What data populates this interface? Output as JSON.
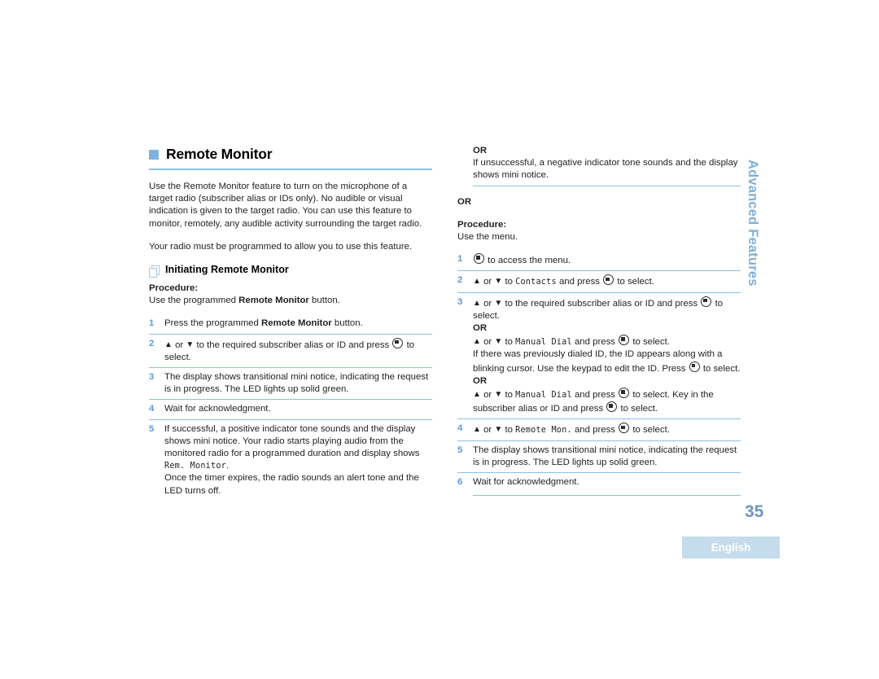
{
  "document": {
    "chapter_title": "Remote Monitor",
    "side_tab": "Advanced Features",
    "page_number": "35",
    "language_badge": "English",
    "accent_blue": "#8cc0e4",
    "number_blue": "#5b9bd5",
    "tab_blue": "#7fb0d6",
    "badge_bg": "#c4dcec"
  },
  "left_column": {
    "intro_paragraph": "Use the Remote Monitor feature to turn on the microphone of a target radio (subscriber alias or IDs only). No audible or visual indication is given to the target radio. You can use this feature to monitor, remotely, any audible activity surrounding the target radio.",
    "second_paragraph": "Your radio must be programmed to allow you to use this feature.",
    "subsection_title": "Initiating Remote Monitor",
    "procedure_label": "Procedure:",
    "procedure_intro_prefix": "Use the programmed ",
    "procedure_intro_bold": "Remote Monitor",
    "procedure_intro_suffix": " button.",
    "steps": [
      {
        "num": "1",
        "prefix": "Press the programmed ",
        "bold": "Remote Monitor",
        "suffix": " button."
      },
      {
        "num": "2",
        "text_a": " or ",
        "text_b": " to the required subscriber alias or ID and press ",
        "text_c": " to select."
      },
      {
        "num": "3",
        "text": "The display shows transitional mini notice, indicating the request is in progress. The LED lights up solid green."
      },
      {
        "num": "4",
        "text": "Wait for acknowledgment."
      },
      {
        "num": "5",
        "text_a": "If successful, a positive indicator tone sounds and the display shows mini notice. Your radio starts playing audio from the monitored radio for a programmed duration and display shows ",
        "mono": "Rem. Monitor",
        "text_b": ".",
        "text_c": "Once the timer expires, the radio sounds an alert tone and the LED turns off."
      }
    ]
  },
  "right_column": {
    "or_top_label": "OR",
    "or_top_text": "If unsuccessful, a negative indicator tone sounds and the display shows mini notice.",
    "or_second_label": "OR",
    "procedure_label": "Procedure:",
    "procedure_intro": "Use the menu.",
    "steps": [
      {
        "num": "1",
        "text": " to access the menu."
      },
      {
        "num": "2",
        "text_a": " or ",
        "text_b": " to ",
        "mono": "Contacts",
        "text_c": " and press ",
        "text_d": " to select."
      },
      {
        "num": "3",
        "text_a": " or ",
        "text_b": " to the required subscriber alias or ID and press ",
        "text_c": " to select.",
        "or_1": "OR",
        "alt1_a": " or ",
        "alt1_b": " to ",
        "alt1_mono": "Manual Dial",
        "alt1_c": " and press ",
        "alt1_d": " to select.",
        "alt1_note_a": "If there was previously dialed ID, the ID appears along with a blinking cursor. Use the keypad to edit the ID. Press ",
        "alt1_note_b": " to select.",
        "or_2": "OR",
        "alt2_a": " or ",
        "alt2_b": " to ",
        "alt2_mono": "Manual Dial",
        "alt2_c": " and press ",
        "alt2_d": " to select. Key in the subscriber alias or ID and press ",
        "alt2_e": " to select."
      },
      {
        "num": "4",
        "text_a": " or ",
        "text_b": " to ",
        "mono": "Remote Mon.",
        "text_c": " and press ",
        "text_d": " to select."
      },
      {
        "num": "5",
        "text": "The display shows transitional mini notice, indicating the request is in progress. The LED lights up solid green."
      },
      {
        "num": "6",
        "text": "Wait for acknowledgment."
      }
    ]
  },
  "icons": {
    "up_arrow": "▲",
    "down_arrow": "▼",
    "menu_button": "menu-button-icon",
    "chapter_marker": "blue-square-icon",
    "subsection_marker": "stacked-pages-icon"
  }
}
